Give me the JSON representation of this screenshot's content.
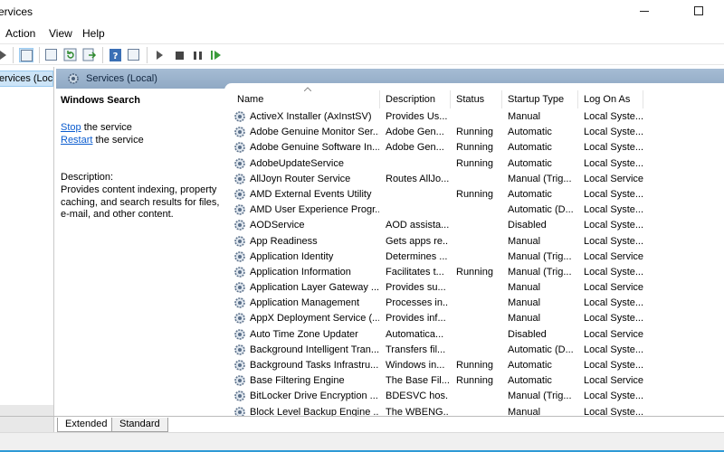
{
  "window": {
    "title": "ervices"
  },
  "menu": {
    "action": "Action",
    "view": "View",
    "help": "Help"
  },
  "tree": {
    "selected": "ervices (Loca"
  },
  "panel": {
    "title": "Services (Local)"
  },
  "details": {
    "service_name": "Windows Search",
    "stop_link": "Stop",
    "stop_suffix": " the service",
    "restart_link": "Restart",
    "restart_suffix": " the service",
    "description_label": "Description:",
    "description_text": "Provides content indexing, property caching, and search results for files, e-mail, and other content."
  },
  "table": {
    "columns": [
      "Name",
      "Description",
      "Status",
      "Startup Type",
      "Log On As"
    ],
    "rows": [
      [
        "ActiveX Installer (AxInstSV)",
        "Provides Us...",
        "",
        "Manual",
        "Local Syste..."
      ],
      [
        "Adobe Genuine Monitor Ser...",
        "Adobe Gen...",
        "Running",
        "Automatic",
        "Local Syste..."
      ],
      [
        "Adobe Genuine Software In...",
        "Adobe Gen...",
        "Running",
        "Automatic",
        "Local Syste..."
      ],
      [
        "AdobeUpdateService",
        "",
        "Running",
        "Automatic",
        "Local Syste..."
      ],
      [
        "AllJoyn Router Service",
        "Routes AllJo...",
        "",
        "Manual (Trig...",
        "Local Service"
      ],
      [
        "AMD External Events Utility",
        "",
        "Running",
        "Automatic",
        "Local Syste..."
      ],
      [
        "AMD User Experience Progr...",
        "",
        "",
        "Automatic (D...",
        "Local Syste..."
      ],
      [
        "AODService",
        "AOD assista...",
        "",
        "Disabled",
        "Local Syste..."
      ],
      [
        "App Readiness",
        "Gets apps re...",
        "",
        "Manual",
        "Local Syste..."
      ],
      [
        "Application Identity",
        "Determines ...",
        "",
        "Manual (Trig...",
        "Local Service"
      ],
      [
        "Application Information",
        "Facilitates t...",
        "Running",
        "Manual (Trig...",
        "Local Syste..."
      ],
      [
        "Application Layer Gateway ...",
        "Provides su...",
        "",
        "Manual",
        "Local Service"
      ],
      [
        "Application Management",
        "Processes in...",
        "",
        "Manual",
        "Local Syste..."
      ],
      [
        "AppX Deployment Service (...",
        "Provides inf...",
        "",
        "Manual",
        "Local Syste..."
      ],
      [
        "Auto Time Zone Updater",
        "Automatica...",
        "",
        "Disabled",
        "Local Service"
      ],
      [
        "Background Intelligent Tran...",
        "Transfers fil...",
        "",
        "Automatic (D...",
        "Local Syste..."
      ],
      [
        "Background Tasks Infrastru...",
        "Windows in...",
        "Running",
        "Automatic",
        "Local Syste..."
      ],
      [
        "Base Filtering Engine",
        "The Base Fil...",
        "Running",
        "Automatic",
        "Local Service"
      ],
      [
        "BitLocker Drive Encryption ...",
        "BDESVC hos...",
        "",
        "Manual (Trig...",
        "Local Syste..."
      ],
      [
        "Block Level Backup Engine ...",
        "The WBENG...",
        "",
        "Manual",
        "Local Syste..."
      ]
    ]
  },
  "tabs": {
    "extended": "Extended",
    "standard": "Standard"
  },
  "colors": {
    "header": "#9db4cd",
    "link": "#0b5ccf",
    "selection": "#cce4f7"
  }
}
